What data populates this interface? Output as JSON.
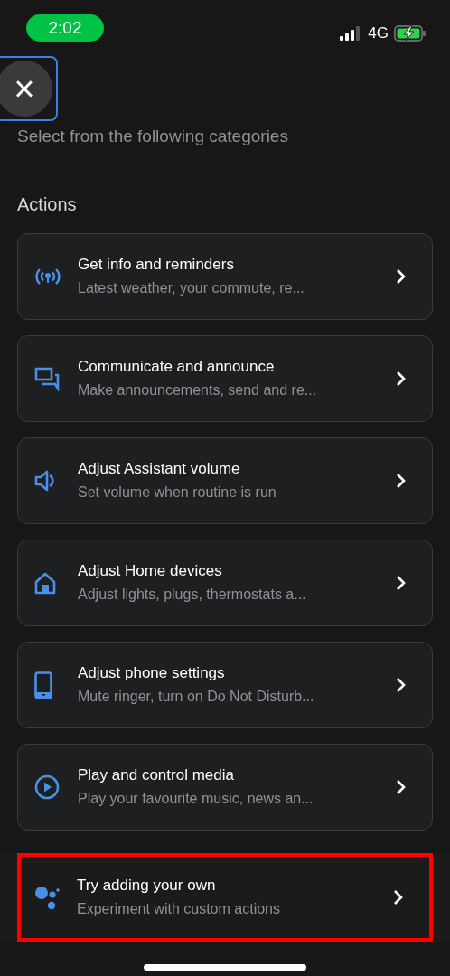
{
  "status_bar": {
    "time": "2:02",
    "network": "4G"
  },
  "close_button": {
    "label": "×",
    "focused": true
  },
  "subtitle": "Select from the following categories",
  "section_title": "Actions",
  "items": [
    {
      "kind": "info",
      "title": "Get info and reminders",
      "subtitle": "Latest weather, your commute, re...",
      "highlighted": false
    },
    {
      "kind": "communicate",
      "title": "Communicate and announce",
      "subtitle": "Make announcements, send and re...",
      "highlighted": false
    },
    {
      "kind": "volume",
      "title": "Adjust Assistant volume",
      "subtitle": "Set volume when routine is run",
      "highlighted": false
    },
    {
      "kind": "home",
      "title": "Adjust Home devices",
      "subtitle": "Adjust lights, plugs, thermostats a...",
      "highlighted": false
    },
    {
      "kind": "phone",
      "title": "Adjust phone settings",
      "subtitle": "Mute ringer, turn on Do Not Disturb...",
      "highlighted": false
    },
    {
      "kind": "media",
      "title": "Play and control media",
      "subtitle": "Play your favourite music, news an...",
      "highlighted": false
    },
    {
      "kind": "custom",
      "title": "Try adding your own",
      "subtitle": "Experiment with custom actions",
      "highlighted": true
    }
  ]
}
